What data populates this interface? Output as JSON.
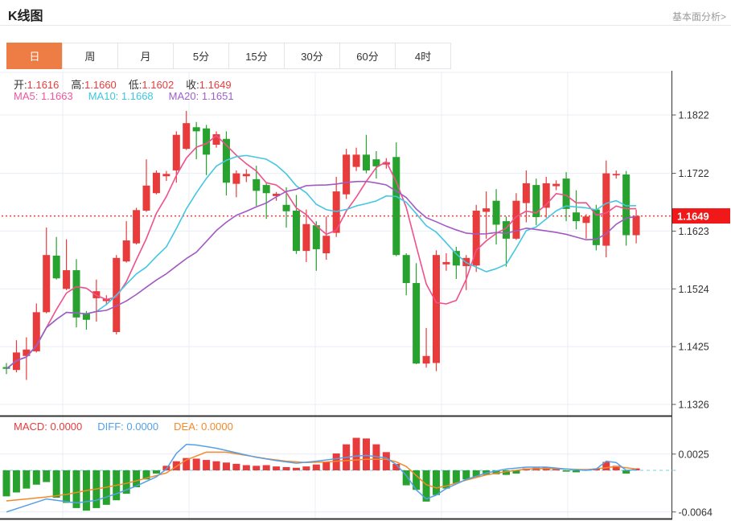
{
  "header": {
    "title": "K线图",
    "link": "基本面分析>"
  },
  "tabs": {
    "active_index": 0,
    "items": [
      {
        "label": "日",
        "name": "tab-day"
      },
      {
        "label": "周",
        "name": "tab-week"
      },
      {
        "label": "月",
        "name": "tab-month"
      },
      {
        "label": "5分",
        "name": "tab-5min"
      },
      {
        "label": "15分",
        "name": "tab-15min"
      },
      {
        "label": "30分",
        "name": "tab-30min"
      },
      {
        "label": "60分",
        "name": "tab-60min"
      },
      {
        "label": "4时",
        "name": "tab-4hour"
      }
    ]
  },
  "legend_ohlc": [
    {
      "label": "开:",
      "value": "1.1616"
    },
    {
      "label": "高:",
      "value": "1.1660"
    },
    {
      "label": "低:",
      "value": "1.1602"
    },
    {
      "label": "收:",
      "value": "1.1649"
    }
  ],
  "legend_ma": [
    {
      "label": "MA5:",
      "value": "1.1663",
      "color": "#f0559e"
    },
    {
      "label": "MA10:",
      "value": "1.1668",
      "color": "#3ec6e0"
    },
    {
      "label": "MA20:",
      "value": "1.1651",
      "color": "#a05fc8"
    }
  ],
  "legend_macd": [
    {
      "label": "MACD:",
      "value": "0.0000",
      "color": "#e83c3c"
    },
    {
      "label": "DIFF:",
      "value": "0.0000",
      "color": "#54a0e8"
    },
    {
      "label": "DEA:",
      "value": "0.0000",
      "color": "#f28a2a"
    }
  ],
  "axis": {
    "price_ticks": [
      {
        "label": "1.1822",
        "price": 1.1822
      },
      {
        "label": "1.1722",
        "price": 1.1722
      },
      {
        "label": "1.1623",
        "price": 1.1623
      },
      {
        "label": "1.1524",
        "price": 1.1524
      },
      {
        "label": "1.1425",
        "price": 1.1425
      },
      {
        "label": "1.1326",
        "price": 1.1326
      }
    ],
    "last_price": {
      "label": "1.1649",
      "price": 1.1649
    },
    "macd_ticks": [
      {
        "label": "0.0025",
        "value": 0.0025
      },
      {
        "label": "-0.0064",
        "value": -0.0064
      }
    ]
  },
  "chart_data": {
    "type": "candlestick+macd",
    "title": "K线图 (daily candlestick with MA5/MA10/MA20 and MACD)",
    "ylim_price": [
      1.1326,
      1.184
    ],
    "ylim_macd": [
      -0.0075,
      0.006
    ],
    "grid": true,
    "last_close": 1.1649,
    "ma_periods": [
      5,
      10,
      20
    ],
    "candles_ohlc": [
      [
        1.139,
        1.1397,
        1.1378,
        1.1387
      ],
      [
        1.1385,
        1.1436,
        1.1381,
        1.1415
      ],
      [
        1.1409,
        1.1441,
        1.1368,
        1.142
      ],
      [
        1.1417,
        1.1499,
        1.1415,
        1.1484
      ],
      [
        1.1484,
        1.1629,
        1.1482,
        1.1582
      ],
      [
        1.1581,
        1.1613,
        1.154,
        1.1542
      ],
      [
        1.1524,
        1.1609,
        1.1522,
        1.1556
      ],
      [
        1.1556,
        1.1575,
        1.1458,
        1.1475
      ],
      [
        1.1482,
        1.1486,
        1.1454,
        1.1471
      ],
      [
        1.1508,
        1.154,
        1.1468,
        1.152
      ],
      [
        1.1503,
        1.1513,
        1.1496,
        1.1507
      ],
      [
        1.145,
        1.1582,
        1.1446,
        1.1577
      ],
      [
        1.1571,
        1.164,
        1.1569,
        1.1607
      ],
      [
        1.1602,
        1.1663,
        1.16,
        1.1659
      ],
      [
        1.1658,
        1.1746,
        1.1656,
        1.1701
      ],
      [
        1.1688,
        1.1727,
        1.1686,
        1.1723
      ],
      [
        1.1717,
        1.1726,
        1.1709,
        1.1721
      ],
      [
        1.1727,
        1.1794,
        1.1706,
        1.1788
      ],
      [
        1.1764,
        1.1829,
        1.1762,
        1.1808
      ],
      [
        1.1801,
        1.181,
        1.1746,
        1.1794
      ],
      [
        1.1799,
        1.1805,
        1.1719,
        1.1754
      ],
      [
        1.1771,
        1.1794,
        1.1766,
        1.1789
      ],
      [
        1.1781,
        1.1794,
        1.1684,
        1.1706
      ],
      [
        1.1704,
        1.1727,
        1.1681,
        1.1722
      ],
      [
        1.1717,
        1.1729,
        1.1707,
        1.1721
      ],
      [
        1.1712,
        1.1735,
        1.1666,
        1.1692
      ],
      [
        1.1702,
        1.1706,
        1.1644,
        1.1688
      ],
      [
        1.1683,
        1.169,
        1.1675,
        1.1687
      ],
      [
        1.1668,
        1.1698,
        1.1629,
        1.1657
      ],
      [
        1.1658,
        1.1685,
        1.1584,
        1.1589
      ],
      [
        1.1589,
        1.166,
        1.157,
        1.1635
      ],
      [
        1.1633,
        1.164,
        1.1555,
        1.1592
      ],
      [
        1.1585,
        1.1648,
        1.1574,
        1.1615
      ],
      [
        1.162,
        1.1716,
        1.1613,
        1.1691
      ],
      [
        1.1686,
        1.1764,
        1.1678,
        1.1754
      ],
      [
        1.1733,
        1.1766,
        1.1726,
        1.1754
      ],
      [
        1.1754,
        1.1788,
        1.1722,
        1.1727
      ],
      [
        1.1746,
        1.176,
        1.1713,
        1.1734
      ],
      [
        1.1737,
        1.1748,
        1.173,
        1.1741
      ],
      [
        1.175,
        1.1775,
        1.158,
        1.1582
      ],
      [
        1.1582,
        1.1585,
        1.1513,
        1.1534
      ],
      [
        1.1534,
        1.1568,
        1.1395,
        1.1396
      ],
      [
        1.1396,
        1.1457,
        1.1389,
        1.1409
      ],
      [
        1.1397,
        1.159,
        1.1383,
        1.1582
      ],
      [
        1.1566,
        1.1585,
        1.1555,
        1.157
      ],
      [
        1.1589,
        1.1596,
        1.1541,
        1.1564
      ],
      [
        1.1563,
        1.1582,
        1.1522,
        1.1577
      ],
      [
        1.1564,
        1.1668,
        1.1553,
        1.1658
      ],
      [
        1.1656,
        1.1691,
        1.161,
        1.1662
      ],
      [
        1.1675,
        1.1695,
        1.16,
        1.1634
      ],
      [
        1.164,
        1.1648,
        1.1562,
        1.161
      ],
      [
        1.161,
        1.1688,
        1.1608,
        1.1675
      ],
      [
        1.1671,
        1.1727,
        1.1638,
        1.1705
      ],
      [
        1.1702,
        1.1713,
        1.1633,
        1.1647
      ],
      [
        1.1663,
        1.1716,
        1.1646,
        1.1705
      ],
      [
        1.17,
        1.171,
        1.1693,
        1.1704
      ],
      [
        1.1713,
        1.1724,
        1.164,
        1.1661
      ],
      [
        1.1655,
        1.1693,
        1.1626,
        1.164
      ],
      [
        1.1637,
        1.1652,
        1.161,
        1.1648
      ],
      [
        1.166,
        1.1668,
        1.159,
        1.1599
      ],
      [
        1.1598,
        1.1744,
        1.1578,
        1.1722
      ],
      [
        1.1719,
        1.1727,
        1.1713,
        1.1721
      ],
      [
        1.172,
        1.1726,
        1.1598,
        1.1616
      ],
      [
        1.1616,
        1.166,
        1.1602,
        1.1649
      ]
    ],
    "macd": {
      "hist": [
        -0.004,
        -0.0034,
        -0.0028,
        -0.0022,
        -0.0018,
        -0.0042,
        -0.005,
        -0.0058,
        -0.0062,
        -0.0058,
        -0.0053,
        -0.0046,
        -0.0036,
        -0.0026,
        -0.0014,
        -0.0005,
        0.0007,
        0.0014,
        0.0019,
        0.0018,
        0.0016,
        0.0014,
        0.0012,
        0.001,
        0.0008,
        0.0007,
        0.0008,
        0.0006,
        0.0005,
        0.0004,
        0.0006,
        0.0009,
        0.0013,
        0.0026,
        0.004,
        0.005,
        0.0049,
        0.004,
        0.0028,
        0.001,
        -0.0023,
        -0.003,
        -0.0048,
        -0.0038,
        -0.0028,
        -0.002,
        -0.0014,
        -0.001,
        -0.0007,
        -0.0006,
        -0.0007,
        -0.0005,
        0.0003,
        0.0004,
        0.0005,
        0.0003,
        -0.0002,
        -0.0003,
        0.0002,
        0.0003,
        0.0013,
        0.0007,
        -0.0005,
        0.0003
      ],
      "diff_points": [
        [
          0,
          -0.0064
        ],
        [
          2,
          -0.0054
        ],
        [
          4,
          -0.0044
        ],
        [
          5,
          -0.0046
        ],
        [
          7,
          -0.005
        ],
        [
          9,
          -0.0046
        ],
        [
          11,
          -0.0036
        ],
        [
          13,
          -0.0024
        ],
        [
          15,
          -0.001
        ],
        [
          16,
          0.0002
        ],
        [
          17,
          0.0026
        ],
        [
          18,
          0.004
        ],
        [
          19,
          0.0039
        ],
        [
          21,
          0.0034
        ],
        [
          23,
          0.0027
        ],
        [
          25,
          0.002
        ],
        [
          27,
          0.0015
        ],
        [
          29,
          0.0011
        ],
        [
          31,
          0.0014
        ],
        [
          33,
          0.0018
        ],
        [
          35,
          0.0022
        ],
        [
          36,
          0.0023
        ],
        [
          38,
          0.0019
        ],
        [
          39,
          0.0009
        ],
        [
          40,
          -0.0008
        ],
        [
          41,
          -0.003
        ],
        [
          42,
          -0.0044
        ],
        [
          43,
          -0.0038
        ],
        [
          44,
          -0.0028
        ],
        [
          46,
          -0.0014
        ],
        [
          48,
          -0.0004
        ],
        [
          50,
          0.0002
        ],
        [
          52,
          0.0005
        ],
        [
          54,
          0.0005
        ],
        [
          56,
          0.0002
        ],
        [
          58,
          0.0
        ],
        [
          59,
          0.0002
        ],
        [
          60,
          0.0014
        ],
        [
          61,
          0.0012
        ],
        [
          62,
          0.0
        ],
        [
          63,
          0.0001
        ]
      ],
      "dea_points": [
        [
          0,
          -0.0047
        ],
        [
          2,
          -0.0044
        ],
        [
          4,
          -0.0041
        ],
        [
          6,
          -0.0037
        ],
        [
          8,
          -0.0031
        ],
        [
          10,
          -0.0026
        ],
        [
          12,
          -0.002
        ],
        [
          14,
          -0.0012
        ],
        [
          16,
          -0.0004
        ],
        [
          18,
          0.0016
        ],
        [
          20,
          0.0028
        ],
        [
          22,
          0.0028
        ],
        [
          24,
          0.0023
        ],
        [
          26,
          0.0018
        ],
        [
          28,
          0.0014
        ],
        [
          30,
          0.0012
        ],
        [
          32,
          0.0013
        ],
        [
          34,
          0.0015
        ],
        [
          36,
          0.0017
        ],
        [
          38,
          0.0017
        ],
        [
          39,
          0.0013
        ],
        [
          40,
          0.0006
        ],
        [
          41,
          -0.0008
        ],
        [
          42,
          -0.0022
        ],
        [
          43,
          -0.0027
        ],
        [
          44,
          -0.0024
        ],
        [
          46,
          -0.0015
        ],
        [
          48,
          -0.0007
        ],
        [
          50,
          -0.0002
        ],
        [
          52,
          0.0002
        ],
        [
          54,
          0.0003
        ],
        [
          56,
          0.0002
        ],
        [
          58,
          0.0001
        ],
        [
          60,
          0.0004
        ],
        [
          61,
          0.0006
        ],
        [
          62,
          0.0004
        ],
        [
          63,
          0.0002
        ]
      ]
    },
    "colors": {
      "up": "#e83c3c",
      "down": "#28a22e",
      "ma5": "#f0508c",
      "ma10": "#45c6e2",
      "ma20": "#a25ac2",
      "diff": "#54a0e8",
      "dea": "#f28a2a",
      "last_line": "#f23b3b",
      "badge": "#f01818",
      "zero_dash": "#8fd9ea",
      "grid": "#e9eef5",
      "frame": "#333333",
      "accent_tab": "#ed7d45"
    }
  }
}
